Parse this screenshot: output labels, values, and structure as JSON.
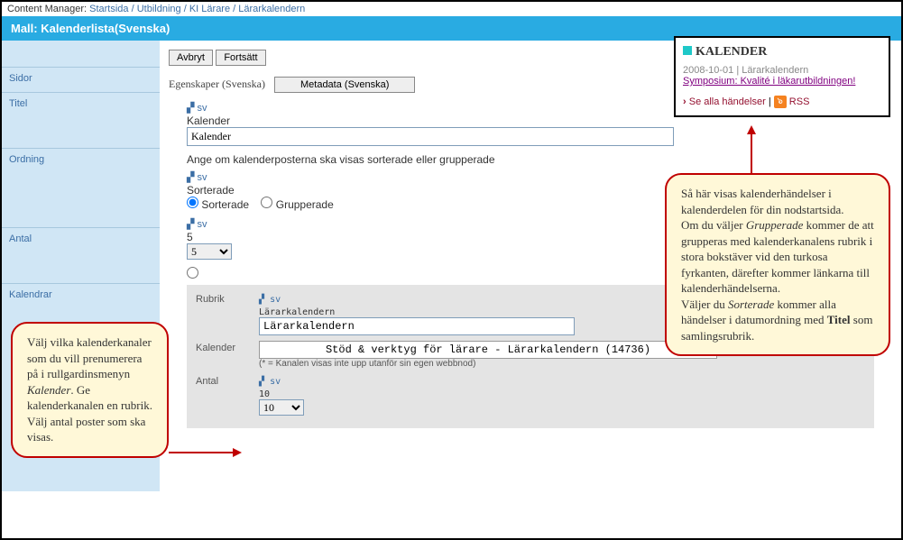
{
  "topbar": {
    "label": "Content Manager:",
    "crumbs": [
      "Startsida",
      "Utbildning",
      "KI Lärare",
      "Lärarkalendern"
    ],
    "sep": "/"
  },
  "bluebar": {
    "text": "Mall: Kalenderlista(Svenska)"
  },
  "sidebar": {
    "sidor": "Sidor",
    "titel": "Titel",
    "ordning": "Ordning",
    "antal": "Antal",
    "kalendrar": "Kalendrar"
  },
  "buttons": {
    "avbryt": "Avbryt",
    "fortsatt": "Fortsätt",
    "metadata": "Metadata (Svenska)"
  },
  "props_label": "Egenskaper (Svenska)",
  "flag_lang": "sv",
  "flag_glyph": "▞",
  "titel": {
    "static": "Kalender",
    "value": "Kalender"
  },
  "ordning": {
    "desc": "Ange om kalenderposterna ska visas sorterade eller grupperade",
    "static": "Sorterade",
    "opt1": "Sorterade",
    "opt2": "Grupperade"
  },
  "antal": {
    "static": "5",
    "value": "5"
  },
  "kalendrar": {
    "rubrik_label": "Rubrik",
    "rubrik_static": "Lärarkalendern",
    "rubrik_value": "Lärarkalendern",
    "kalender_label": "Kalender",
    "kalender_value": "Stöd & verktyg för lärare - Lärarkalendern (14736)",
    "kalender_note": "(* = Kanalen visas inte upp utanför sin egen webbnod)",
    "antal_label": "Antal",
    "antal_static": "10",
    "antal_value": "10"
  },
  "kalenderbox": {
    "heading": "KALENDER",
    "date": "2008-10-01 | Lärarkalendern",
    "link": "Symposium: Kvalité i läkarutbildningen!",
    "all": "Se alla händelser",
    "pipe": "|",
    "rss": "RSS",
    "chev": "›"
  },
  "callout_left": {
    "text_parts": [
      "Välj vilka kalenderkanaler som du vill prenumerera på i rullgardinsmenyn ",
      "Kalender",
      ". Ge kalenderkanalen en rubrik. Välj antal poster som ska visas."
    ]
  },
  "callout_right": {
    "p1_parts": [
      "Så här visas kalenderhändelser i kalenderdelen för din nodstartsida."
    ],
    "p2_parts": [
      "Om du väljer ",
      "Grupperade",
      " kommer de att grupperas med kalenderkanalens rubrik i stora bokstäver vid den turkosa fyrkanten, därefter kommer länkarna till kalenderhändelserna."
    ],
    "p3_parts": [
      "Väljer du ",
      "Sorterade",
      " kommer alla händelser i datumordning med ",
      "Titel",
      " som samlingsrubrik."
    ]
  }
}
